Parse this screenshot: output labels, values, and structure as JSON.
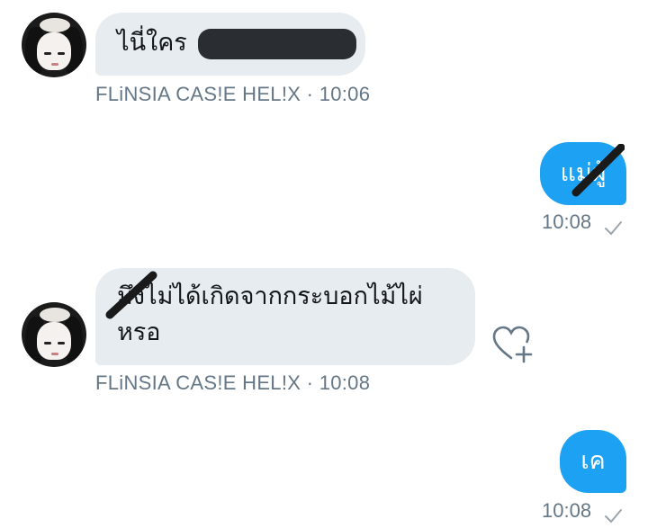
{
  "messages": [
    {
      "sender": "FLiNSIA CAS!E HEL!X",
      "time": "10:06",
      "text": "ไนี่ใคร"
    },
    {
      "time": "10:08",
      "text": "แม่ผู้"
    },
    {
      "sender": "FLiNSIA CAS!E HEL!X",
      "time": "10:08",
      "line1_struck": "มึง",
      "line1": "ไม่ได้เกิดจากกระบอกไม้ไผ่",
      "line2": "หรอ"
    },
    {
      "time": "10:08",
      "text": "เค"
    }
  ],
  "colors": {
    "incoming_bubble": "#e6ecf0",
    "outgoing_bubble": "#1da1f2",
    "meta_text": "#657786"
  },
  "icons": {
    "like": "heart-plus-icon",
    "read": "check-icon"
  }
}
